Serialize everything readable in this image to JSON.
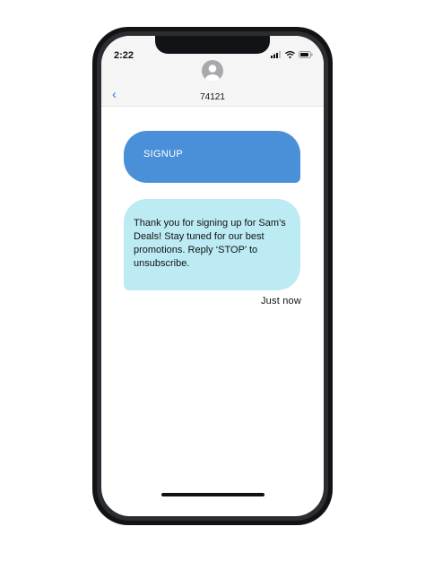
{
  "status_bar": {
    "time": "2:22",
    "signal_icon": "cellular-signal-icon",
    "wifi_icon": "wifi-icon",
    "battery_icon": "battery-icon"
  },
  "conversation": {
    "back_icon": "chevron-left-icon",
    "back_glyph": "‹",
    "avatar_icon": "contact-avatar-icon",
    "contact_name": "74121"
  },
  "messages": [
    {
      "direction": "sent",
      "text": "SIGNUP"
    },
    {
      "direction": "received",
      "text": "Thank you for signing up for Sam’s Deals! Stay tuned for our best promotions. Reply ‘STOP’ to unsubscribe."
    }
  ],
  "timestamp": "Just now",
  "colors": {
    "sent_bubble": "#4a90d9",
    "received_bubble": "#bcebf4",
    "accent": "#3a7fd8",
    "phone_frame": "#111316"
  }
}
